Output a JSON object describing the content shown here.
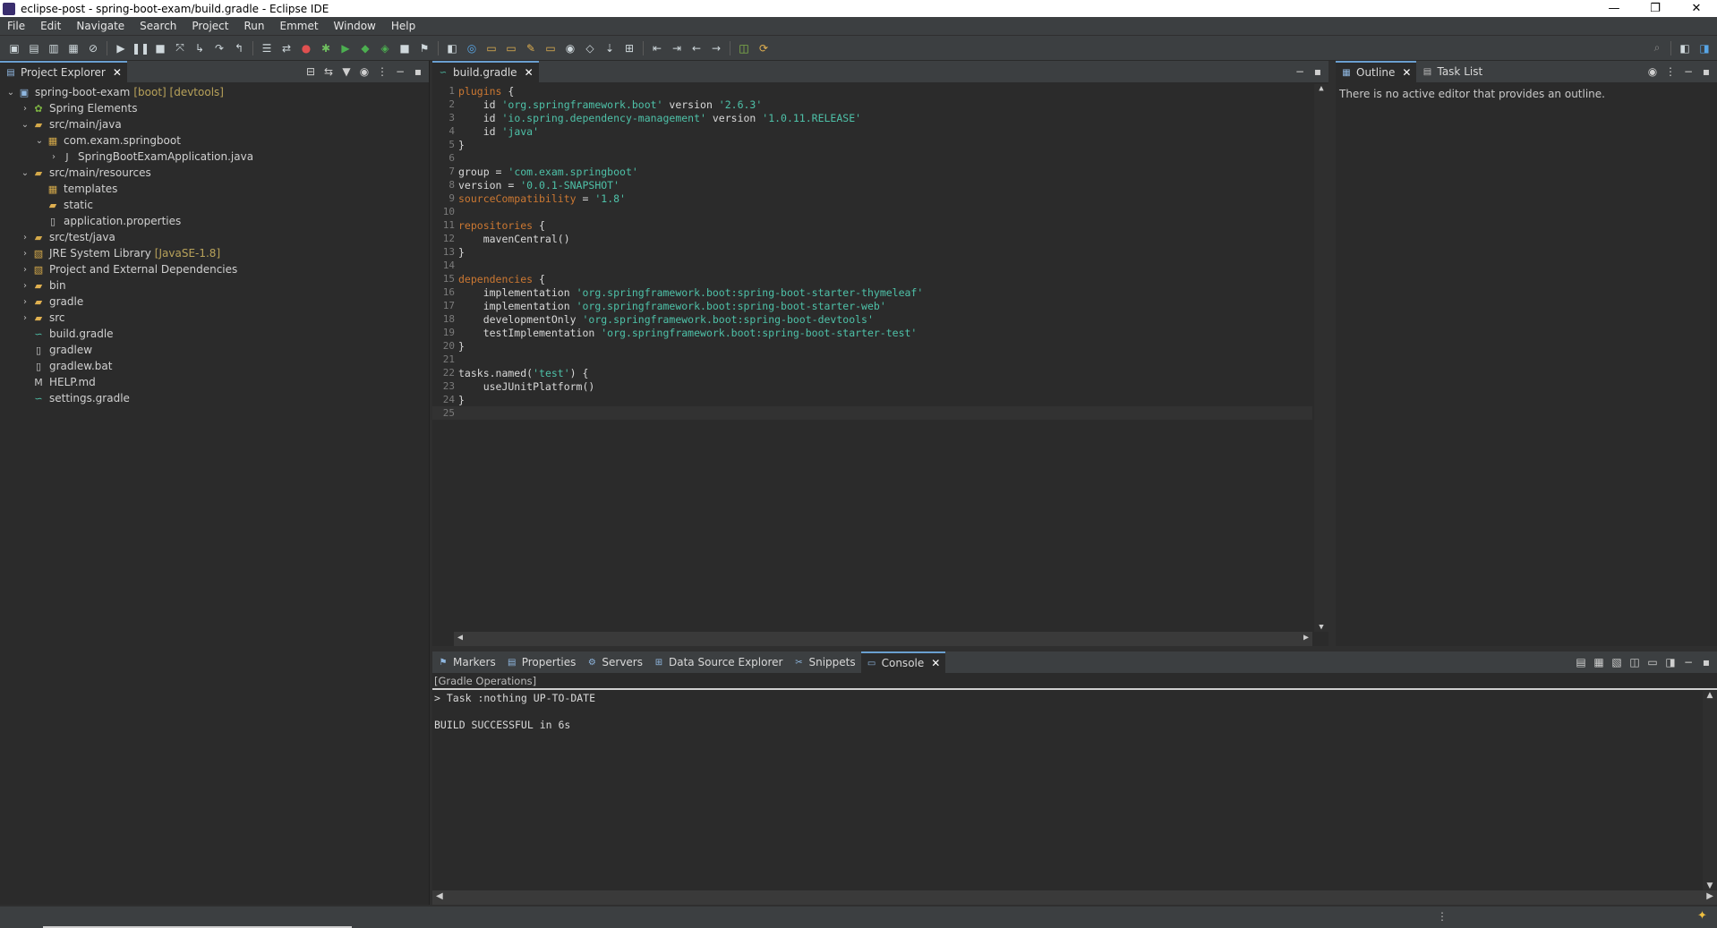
{
  "window": {
    "title": "eclipse-post - spring-boot-exam/build.gradle - Eclipse IDE",
    "controls": [
      "—",
      "❐",
      "✕"
    ]
  },
  "menu": [
    "File",
    "Edit",
    "Navigate",
    "Search",
    "Project",
    "Run",
    "Emmet",
    "Window",
    "Help"
  ],
  "explorer": {
    "tab_label": "Project Explorer",
    "items": [
      {
        "label": "spring-boot-exam",
        "deco": "[boot] [devtools]",
        "icon": "project-icon",
        "twisty": "open",
        "depth": 0
      },
      {
        "label": "Spring Elements",
        "deco": "",
        "icon": "spring-icon",
        "twisty": "closed",
        "depth": 1
      },
      {
        "label": "src/main/java",
        "deco": "",
        "icon": "source-folder-icon",
        "twisty": "open",
        "depth": 1
      },
      {
        "label": "com.exam.springboot",
        "deco": "",
        "icon": "package-icon",
        "twisty": "open",
        "depth": 2
      },
      {
        "label": "SpringBootExamApplication.java",
        "deco": "",
        "icon": "java-file-icon",
        "twisty": "closed",
        "depth": 3
      },
      {
        "label": "src/main/resources",
        "deco": "",
        "icon": "source-folder-icon",
        "twisty": "open",
        "depth": 1
      },
      {
        "label": "templates",
        "deco": "",
        "icon": "package-icon",
        "twisty": "",
        "depth": 2
      },
      {
        "label": "static",
        "deco": "",
        "icon": "folder-icon",
        "twisty": "",
        "depth": 2
      },
      {
        "label": "application.properties",
        "deco": "",
        "icon": "file-icon",
        "twisty": "",
        "depth": 2
      },
      {
        "label": "src/test/java",
        "deco": "",
        "icon": "source-folder-icon",
        "twisty": "closed",
        "depth": 1
      },
      {
        "label": "JRE System Library",
        "deco": "[JavaSE-1.8]",
        "icon": "library-icon",
        "twisty": "closed",
        "depth": 1
      },
      {
        "label": "Project and External Dependencies",
        "deco": "",
        "icon": "library-icon",
        "twisty": "closed",
        "depth": 1
      },
      {
        "label": "bin",
        "deco": "",
        "icon": "folder-icon",
        "twisty": "closed",
        "depth": 1
      },
      {
        "label": "gradle",
        "deco": "",
        "icon": "folder-icon",
        "twisty": "closed",
        "depth": 1
      },
      {
        "label": "src",
        "deco": "",
        "icon": "folder-icon",
        "twisty": "closed",
        "depth": 1
      },
      {
        "label": "build.gradle",
        "deco": "",
        "icon": "gradle-file-icon",
        "twisty": "",
        "depth": 1
      },
      {
        "label": "gradlew",
        "deco": "",
        "icon": "file-icon",
        "twisty": "",
        "depth": 1
      },
      {
        "label": "gradlew.bat",
        "deco": "",
        "icon": "file-icon",
        "twisty": "",
        "depth": 1
      },
      {
        "label": "HELP.md",
        "deco": "",
        "icon": "markdown-file-icon",
        "twisty": "",
        "depth": 1
      },
      {
        "label": "settings.gradle",
        "deco": "",
        "icon": "gradle-file-icon",
        "twisty": "",
        "depth": 1
      }
    ]
  },
  "editor": {
    "tab_label": "build.gradle",
    "lines": [
      [
        [
          "kw",
          "plugins"
        ],
        [
          "t",
          " {"
        ]
      ],
      [
        [
          "t",
          "    id "
        ],
        [
          "s",
          "'org.springframework.boot'"
        ],
        [
          "t",
          " version "
        ],
        [
          "s",
          "'2.6.3'"
        ]
      ],
      [
        [
          "t",
          "    id "
        ],
        [
          "s",
          "'io.spring.dependency-management'"
        ],
        [
          "t",
          " version "
        ],
        [
          "s",
          "'1.0.11.RELEASE'"
        ]
      ],
      [
        [
          "t",
          "    id "
        ],
        [
          "s",
          "'java'"
        ]
      ],
      [
        [
          "t",
          "}"
        ]
      ],
      [],
      [
        [
          "t",
          "group = "
        ],
        [
          "s",
          "'com.exam.springboot'"
        ]
      ],
      [
        [
          "t",
          "version = "
        ],
        [
          "s",
          "'0.0.1-SNAPSHOT'"
        ]
      ],
      [
        [
          "kw",
          "sourceCompatibility"
        ],
        [
          "t",
          " = "
        ],
        [
          "s",
          "'1.8'"
        ]
      ],
      [],
      [
        [
          "kw",
          "repositories"
        ],
        [
          "t",
          " {"
        ]
      ],
      [
        [
          "t",
          "    mavenCentral()"
        ]
      ],
      [
        [
          "t",
          "}"
        ]
      ],
      [],
      [
        [
          "kw",
          "dependencies"
        ],
        [
          "t",
          " {"
        ]
      ],
      [
        [
          "t",
          "    implementation "
        ],
        [
          "s",
          "'org.springframework.boot:spring-boot-starter-thymeleaf'"
        ]
      ],
      [
        [
          "t",
          "    implementation "
        ],
        [
          "s",
          "'org.springframework.boot:spring-boot-starter-web'"
        ]
      ],
      [
        [
          "t",
          "    developmentOnly "
        ],
        [
          "s",
          "'org.springframework.boot:spring-boot-devtools'"
        ]
      ],
      [
        [
          "t",
          "    testImplementation "
        ],
        [
          "s",
          "'org.springframework.boot:spring-boot-starter-test'"
        ]
      ],
      [
        [
          "t",
          "}"
        ]
      ],
      [],
      [
        [
          "t",
          "tasks.named("
        ],
        [
          "s",
          "'test'"
        ],
        [
          "t",
          ") {"
        ]
      ],
      [
        [
          "t",
          "    useJUnitPlatform()"
        ]
      ],
      [
        [
          "t",
          "}"
        ]
      ],
      []
    ]
  },
  "outline": {
    "tabs": [
      {
        "label": "Outline",
        "active": true
      },
      {
        "label": "Task List",
        "active": false
      }
    ],
    "message": "There is no active editor that provides an outline."
  },
  "bottom": {
    "tabs": [
      {
        "label": "Markers",
        "icon": "markers-icon",
        "active": false
      },
      {
        "label": "Properties",
        "icon": "properties-icon",
        "active": false
      },
      {
        "label": "Servers",
        "icon": "servers-icon",
        "active": false
      },
      {
        "label": "Data Source Explorer",
        "icon": "data-source-icon",
        "active": false
      },
      {
        "label": "Snippets",
        "icon": "snippets-icon",
        "active": false
      },
      {
        "label": "Console",
        "icon": "console-icon",
        "active": true
      }
    ],
    "console_header": "[Gradle Operations]",
    "console_lines": [
      "> Task :nothing UP-TO-DATE",
      "",
      "BUILD SUCCESSFUL in 6s"
    ]
  }
}
